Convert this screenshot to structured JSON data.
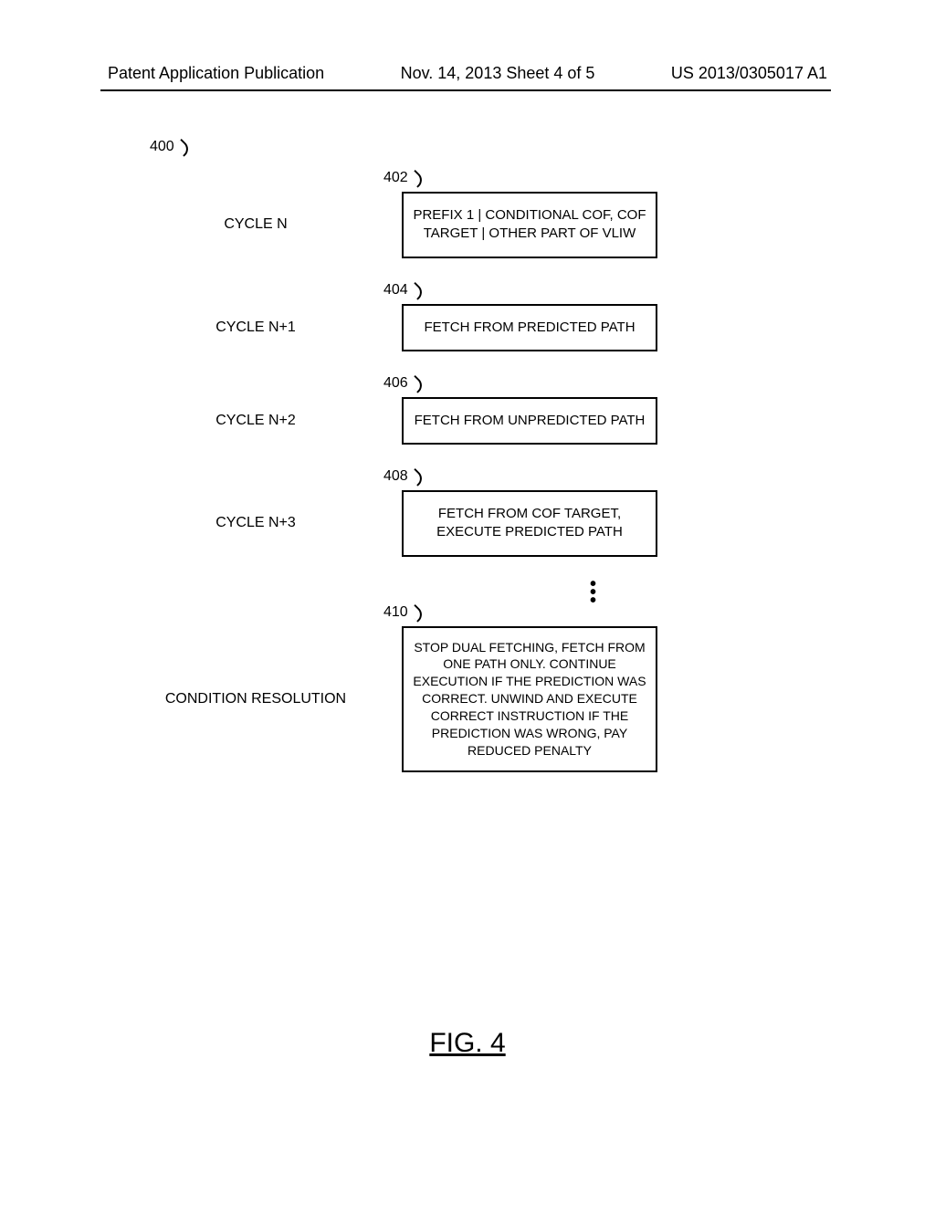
{
  "header": {
    "left": "Patent Application Publication",
    "mid": "Nov. 14, 2013  Sheet 4 of 5",
    "right": "US 2013/0305017 A1"
  },
  "diagram": {
    "topRef": "400",
    "rows": [
      {
        "label": "CYCLE N",
        "ref": "402",
        "text": "PREFIX 1 | CONDITIONAL COF, COF TARGET | OTHER PART OF VLIW"
      },
      {
        "label": "CYCLE N+1",
        "ref": "404",
        "text": "FETCH FROM PREDICTED PATH"
      },
      {
        "label": "CYCLE N+2",
        "ref": "406",
        "text": "FETCH FROM UNPREDICTED PATH"
      },
      {
        "label": "CYCLE N+3",
        "ref": "408",
        "text": "FETCH FROM COF TARGET, EXECUTE PREDICTED PATH"
      },
      {
        "label": "CONDITION RESOLUTION",
        "ref": "410",
        "text": "STOP DUAL FETCHING, FETCH FROM ONE PATH ONLY. CONTINUE EXECUTION IF THE PREDICTION WAS CORRECT. UNWIND AND EXECUTE CORRECT INSTRUCTION IF THE PREDICTION WAS WRONG, PAY REDUCED PENALTY"
      }
    ]
  },
  "figure": "FIG. 4"
}
